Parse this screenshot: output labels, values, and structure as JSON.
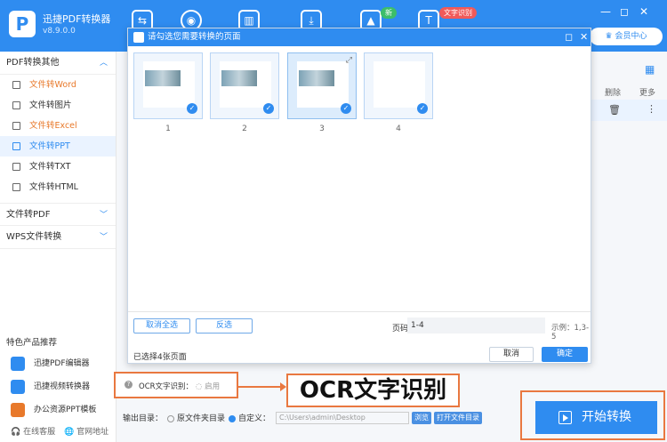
{
  "app": {
    "name": "迅捷PDF转换器",
    "version": "v8.9.0.0",
    "member": "会员中心"
  },
  "topnav": {
    "icons": [
      "convert-icon",
      "tool-icon",
      "audio-icon",
      "download-icon",
      "image-icon",
      "text-icon"
    ],
    "badge_new": "新",
    "badge_ocr": "文字识别"
  },
  "sidebar": {
    "group1": "PDF转换其他",
    "items": [
      {
        "label": "文件转Word",
        "state": "orange"
      },
      {
        "label": "文件转图片",
        "state": ""
      },
      {
        "label": "文件转Excel",
        "state": "orange"
      },
      {
        "label": "文件转PPT",
        "state": "active"
      },
      {
        "label": "文件转TXT",
        "state": ""
      },
      {
        "label": "文件转HTML",
        "state": ""
      }
    ],
    "group2": "文件转PDF",
    "group3": "WPS文件转换",
    "feat_title": "特色产品推荐",
    "features": [
      "迅捷PDF编辑器",
      "迅捷视频转换器",
      "办公资源PPT模板"
    ],
    "online": "在线客服",
    "site": "官网地址"
  },
  "right": {
    "delete": "删除",
    "more": "更多"
  },
  "dialog": {
    "title": "请勾选您需要转换的页面",
    "pages": [
      "1",
      "2",
      "3",
      "4"
    ],
    "cancel_all": "取消全选",
    "invert": "反选",
    "page_label": "页码",
    "page_value": "1-4",
    "example": "示例：1,3-5",
    "selected": "已选择4张页面",
    "cancel": "取消",
    "ok": "确定"
  },
  "ocr": {
    "label": "OCR文字识别：",
    "enable": "启用",
    "big": "OCR文字识别"
  },
  "output": {
    "label": "输出目录：",
    "opt1": "原文件夹目录",
    "opt2": "自定义：",
    "path": "C:\\Users\\admin\\Desktop",
    "browse": "浏览",
    "open": "打开文件目录"
  },
  "start": "开始转换"
}
